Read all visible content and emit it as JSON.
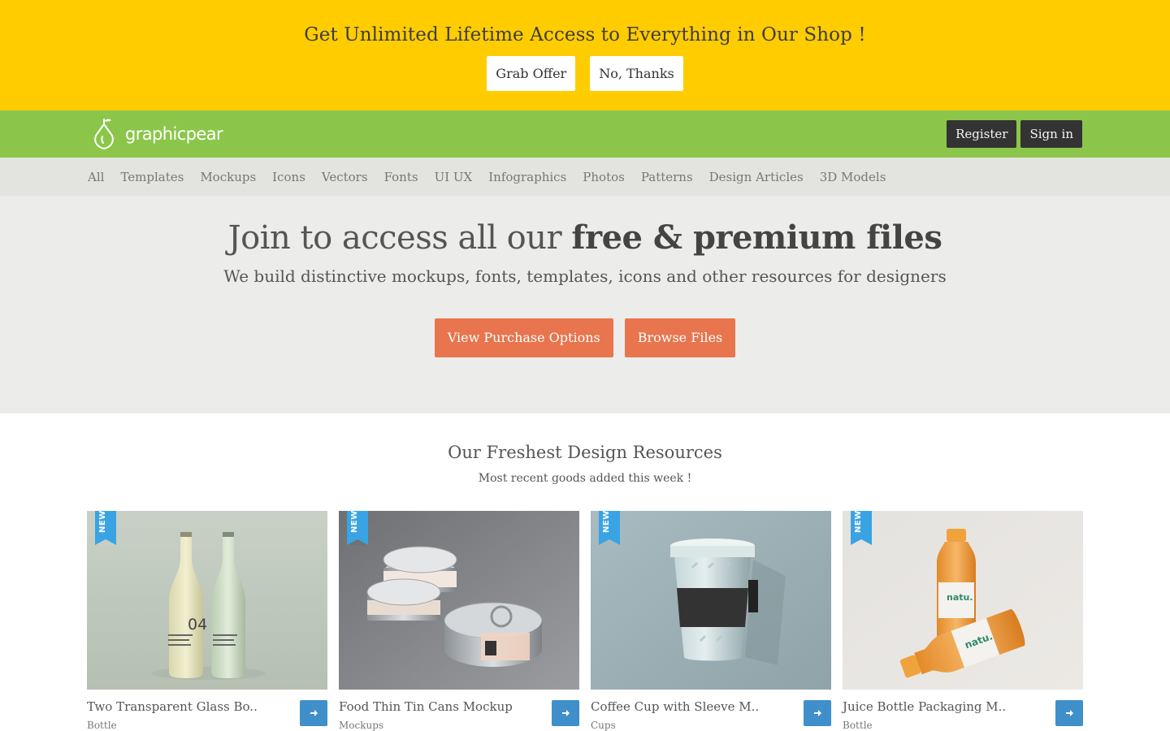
{
  "promo": {
    "headline": "Get Unlimited Lifetime Access to Everything in Our Shop !",
    "grab_label": "Grab Offer",
    "decline_label": "No, Thanks",
    "bg_color": "#ffcc00"
  },
  "header": {
    "logo_text": "graphicpear",
    "register_label": "Register",
    "signin_label": "Sign in",
    "bg_color": "#8bc64b"
  },
  "nav": {
    "items": [
      "All",
      "Templates",
      "Mockups",
      "Icons",
      "Vectors",
      "Fonts",
      "UI UX",
      "Infographics",
      "Photos",
      "Patterns",
      "Design Articles",
      "3D Models"
    ]
  },
  "hero": {
    "title_light": "Join to access all our ",
    "title_bold": "free & premium files",
    "subtitle": "We build distinctive mockups, fonts, templates, icons and other resources for designers",
    "purchase_label": "View Purchase Options",
    "browse_label": "Browse Files",
    "accent_color": "#e8754d"
  },
  "resources": {
    "heading": "Our Freshest Design Resources",
    "subheading": "Most recent goods added this week !",
    "badge": "NEW",
    "items": [
      {
        "title": "Two Transparent Glass Bo..",
        "category": "Bottle",
        "image": "glass-bottles-image"
      },
      {
        "title": "Food Thin Tin Cans Mockup",
        "category": "Mockups",
        "image": "tin-cans-image"
      },
      {
        "title": "Coffee Cup with Sleeve M..",
        "category": "Cups",
        "image": "coffee-cup-image"
      },
      {
        "title": "Juice Bottle Packaging M..",
        "category": "Bottle",
        "image": "juice-bottles-image"
      }
    ]
  }
}
